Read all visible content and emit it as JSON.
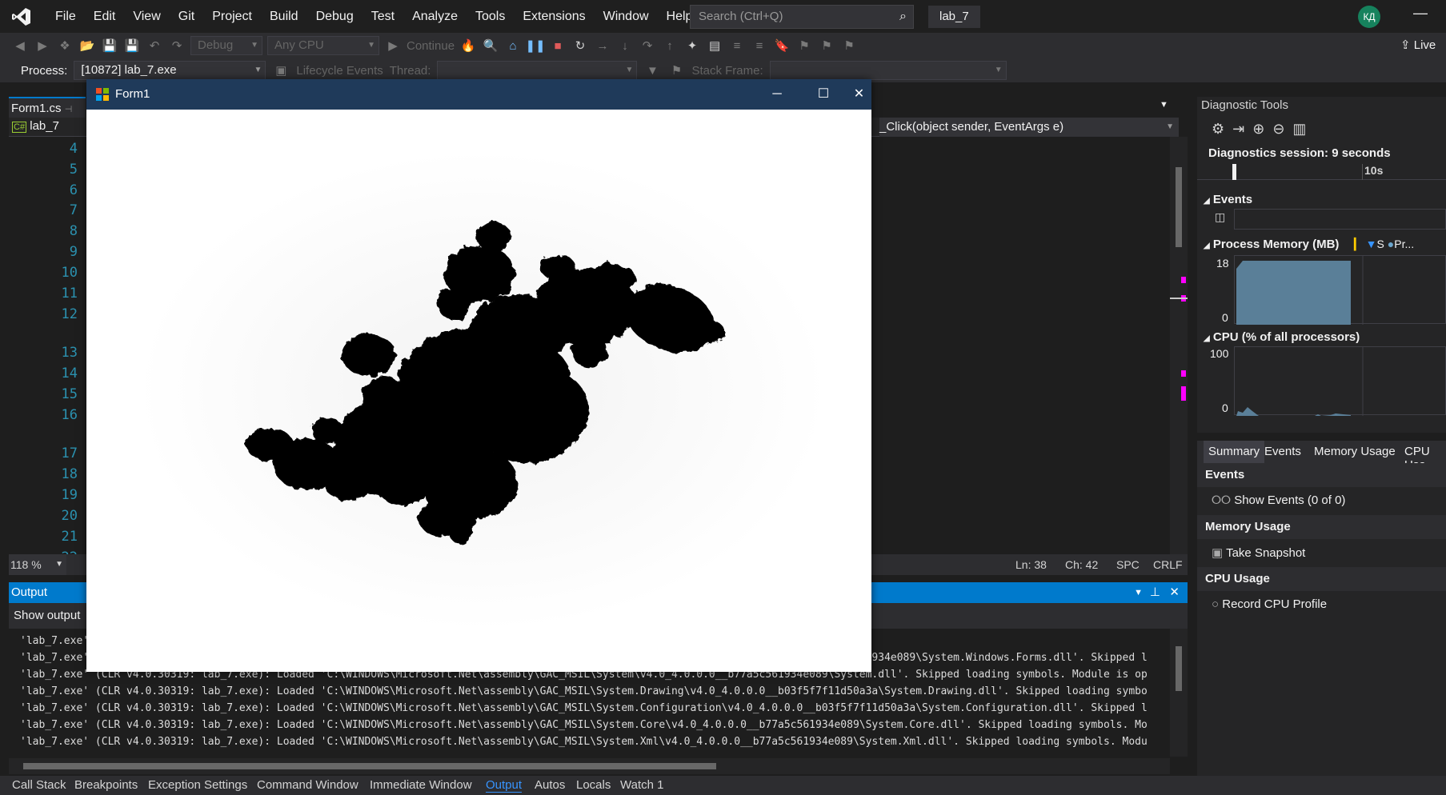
{
  "menu": {
    "items": [
      "File",
      "Edit",
      "View",
      "Git",
      "Project",
      "Build",
      "Debug",
      "Test",
      "Analyze",
      "Tools",
      "Extensions",
      "Window",
      "Help"
    ],
    "search_placeholder": "Search (Ctrl+Q)",
    "solution_name": "lab_7",
    "user_initials": "КД"
  },
  "toolbar": {
    "config": "Debug",
    "platform": "Any CPU",
    "continue_label": "Continue",
    "live_label": "Live",
    "process_label": "Process:",
    "process_value": "[10872] lab_7.exe",
    "lifecycle_label": "Lifecycle Events",
    "thread_label": "Thread:",
    "stack_frame_label": "Stack Frame:"
  },
  "editor": {
    "tab_label": "Form1.cs",
    "project_label": "lab_7",
    "method_label": "_Click(object sender, EventArgs e)",
    "line_numbers": [
      "4",
      "5",
      "6",
      "7",
      "8",
      "9",
      "10",
      "11",
      "12",
      "13",
      "14",
      "15",
      "16",
      "17",
      "18",
      "19",
      "20",
      "21",
      "22"
    ],
    "zoom": "118 %",
    "status": {
      "ln": "Ln: 38",
      "ch": "Ch: 42",
      "spc": "SPC",
      "crlf": "CRLF"
    }
  },
  "form": {
    "title": "Form1"
  },
  "diagnostics": {
    "title": "Diagnostic Tools",
    "session": "Diagnostics session: 9 seconds",
    "timeline_label": "10s",
    "events_label": "Events",
    "memory_label": "Process Memory (MB)",
    "memory_legend_s": "S",
    "memory_legend_pr": "Pr...",
    "memory_max": "18",
    "memory_min": "0",
    "cpu_label": "CPU (% of all processors)",
    "cpu_max": "100",
    "cpu_min": "0",
    "tabs": [
      "Summary",
      "Events",
      "Memory Usage",
      "CPU Usa"
    ],
    "summary": {
      "events_header": "Events",
      "show_events": "Show Events (0 of 0)",
      "memory_header": "Memory Usage",
      "take_snapshot": "Take Snapshot",
      "cpu_header": "CPU Usage",
      "record_cpu": "Record CPU Profile"
    }
  },
  "output": {
    "title": "Output",
    "show_output_from": "Show output",
    "lines": [
      "'lab_7.exe' (CLR v4.0.30319: lab_7.exe): Loaded 'C:\\Users\\...\\bin\\Debug\\lab_7.exe'. Symbols loaded.",
      "'lab_7.exe' (CLR v4.0.30319: lab_7.exe): Loaded 'C:\\WINDOWS\\Microsoft.Net\\assembly\\GAC_MSIL\\System.Windows.Forms\\v4.0_4.0.0.0__b77a5c561934e089\\System.Windows.Forms.dll'. Skipped l",
      "'lab_7.exe' (CLR v4.0.30319: lab_7.exe): Loaded 'C:\\WINDOWS\\Microsoft.Net\\assembly\\GAC_MSIL\\System\\v4.0_4.0.0.0__b77a5c561934e089\\System.dll'. Skipped loading symbols. Module is op",
      "'lab_7.exe' (CLR v4.0.30319: lab_7.exe): Loaded 'C:\\WINDOWS\\Microsoft.Net\\assembly\\GAC_MSIL\\System.Drawing\\v4.0_4.0.0.0__b03f5f7f11d50a3a\\System.Drawing.dll'. Skipped loading symbo",
      "'lab_7.exe' (CLR v4.0.30319: lab_7.exe): Loaded 'C:\\WINDOWS\\Microsoft.Net\\assembly\\GAC_MSIL\\System.Configuration\\v4.0_4.0.0.0__b03f5f7f11d50a3a\\System.Configuration.dll'. Skipped l",
      "'lab_7.exe' (CLR v4.0.30319: lab_7.exe): Loaded 'C:\\WINDOWS\\Microsoft.Net\\assembly\\GAC_MSIL\\System.Core\\v4.0_4.0.0.0__b77a5c561934e089\\System.Core.dll'. Skipped loading symbols. Mo",
      "'lab_7.exe' (CLR v4.0.30319: lab_7.exe): Loaded 'C:\\WINDOWS\\Microsoft.Net\\assembly\\GAC_MSIL\\System.Xml\\v4.0_4.0.0.0__b77a5c561934e089\\System.Xml.dll'. Skipped loading symbols. Modu"
    ]
  },
  "bottom_tabs": [
    "Call Stack",
    "Breakpoints",
    "Exception Settings",
    "Command Window",
    "Immediate Window",
    "Output",
    "Autos",
    "Locals",
    "Watch 1"
  ],
  "colors": {
    "accent": "#007acc",
    "bg": "#1e1e1e",
    "line_number": "#2b91af",
    "form_title": "#1f3a5a"
  }
}
